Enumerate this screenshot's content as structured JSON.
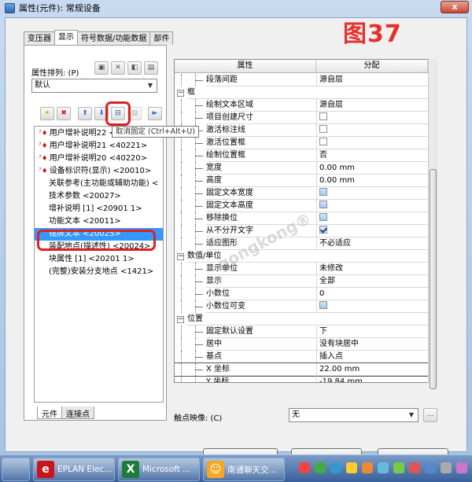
{
  "window": {
    "title": "属性(元件): 常规设备",
    "close_label": "x"
  },
  "badge_text": "图37",
  "tabs": [
    "变压器",
    "显示",
    "符号数据/功能数据",
    "部件"
  ],
  "left": {
    "arrange_label": "属性排列: (P)",
    "arrange_value": "默认",
    "tooltip": "取消固定 (Ctrl+Alt+U)",
    "tree_items": [
      {
        "text": "用户增补说明22 <4022",
        "marked": true
      },
      {
        "text": "用户增补说明21 <40221>",
        "marked": true
      },
      {
        "text": "用户增补说明20 <40220>",
        "marked": true
      },
      {
        "text": "设备标识符(显示) <20010>",
        "marked": true
      },
      {
        "text": "关联参考(主功能或辅助功能) <",
        "marked": false
      },
      {
        "text": "技术参数 <20027>",
        "marked": false
      },
      {
        "text": "增补说明 [1] <20901 1>",
        "marked": false
      },
      {
        "text": "功能文本 <20011>",
        "marked": false
      },
      {
        "text": "铭牌文本 <20025>",
        "marked": false,
        "selected": true
      },
      {
        "text": "装配地点(描述性) <20024>",
        "marked": false
      },
      {
        "text": "块属性 [1] <20201 1>",
        "marked": false
      },
      {
        "text": "(完整)安装分支地点 <1421>",
        "marked": false
      }
    ],
    "bottom_tabs": [
      "元件",
      "连接点"
    ]
  },
  "grid": {
    "headers": [
      "属性",
      "分配"
    ],
    "rows": [
      {
        "name": "段落间距",
        "value": "源自层",
        "level": 2,
        "type": "text"
      },
      {
        "name": "框",
        "value": "",
        "level": 0,
        "type": "group"
      },
      {
        "name": "绘制文本区域",
        "value": "源自层",
        "level": 1,
        "type": "text"
      },
      {
        "name": "项目创建尺寸",
        "value": "",
        "level": 1,
        "type": "cb"
      },
      {
        "name": "激活标注线",
        "value": "",
        "level": 1,
        "type": "cb"
      },
      {
        "name": "激活位置框",
        "value": "",
        "level": 1,
        "type": "cb"
      },
      {
        "name": "绘制位置框",
        "value": "否",
        "level": 1,
        "type": "text"
      },
      {
        "name": "宽度",
        "value": "0.00 mm",
        "level": 1,
        "type": "text"
      },
      {
        "name": "高度",
        "value": "0.00 mm",
        "level": 1,
        "type": "text"
      },
      {
        "name": "固定文本宽度",
        "value": "",
        "level": 1,
        "type": "cb-blue"
      },
      {
        "name": "固定文本高度",
        "value": "",
        "level": 1,
        "type": "cb-blue"
      },
      {
        "name": "移除换位",
        "value": "",
        "level": 1,
        "type": "cb-blue"
      },
      {
        "name": "从不分开文字",
        "value": "",
        "level": 1,
        "type": "cb-checked"
      },
      {
        "name": "适应图形",
        "value": "不必适应",
        "level": 1,
        "type": "text"
      },
      {
        "name": "数值/单位",
        "value": "",
        "level": 0,
        "type": "group"
      },
      {
        "name": "显示单位",
        "value": "未修改",
        "level": 1,
        "type": "text"
      },
      {
        "name": "显示",
        "value": "全部",
        "level": 1,
        "type": "text"
      },
      {
        "name": "小数位",
        "value": "0",
        "level": 1,
        "type": "text"
      },
      {
        "name": "小数位可变",
        "value": "",
        "level": 1,
        "type": "cb-blue"
      },
      {
        "name": "位置",
        "value": "",
        "level": 0,
        "type": "group"
      },
      {
        "name": "固定默认设置",
        "value": "下",
        "level": 1,
        "type": "text"
      },
      {
        "name": "居中",
        "value": "没有块居中",
        "level": 1,
        "type": "text"
      },
      {
        "name": "基点",
        "value": "插入点",
        "level": 1,
        "type": "text"
      },
      {
        "name": "X 坐标",
        "value": "22.00 mm",
        "level": 1,
        "type": "text",
        "selected": true
      },
      {
        "name": "Y 坐标",
        "value": "-19.84 mm",
        "level": 1,
        "type": "text"
      }
    ]
  },
  "trigger": {
    "label": "触点映像: (C)",
    "value": "无",
    "more": "..."
  },
  "watermark": "gongkong®",
  "taskbar": [
    {
      "label": "EPLAN Elec...",
      "icon_color": "#c8161d",
      "glyph": "e"
    },
    {
      "label": "Microsoft ...",
      "icon_color": "#1e7b3c",
      "glyph": "X"
    },
    {
      "label": "南通聊天交...",
      "icon_color": "#f5a623",
      "glyph": "☺"
    }
  ],
  "colors": {
    "accent_red": "#e02020",
    "selection": "#3399ff",
    "badge": "#e8302b"
  }
}
